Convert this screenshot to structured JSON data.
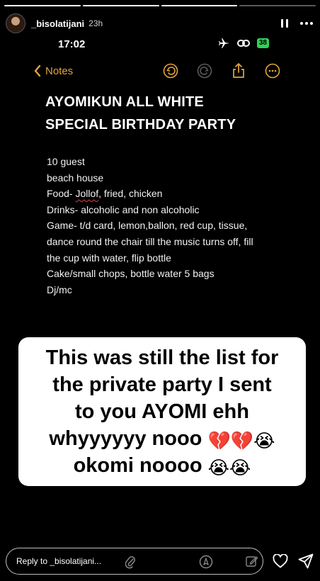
{
  "story": {
    "segments": 4,
    "username": "_bisolatijani",
    "time_ago": "23h"
  },
  "status_bar": {
    "clock": "17:02",
    "battery": "38"
  },
  "notes": {
    "back_label": "Notes",
    "title_lines": [
      "AYOMIKUN ALL WHITE",
      "SPECIAL BIRTHDAY PARTY"
    ],
    "body": {
      "guests": "10 guest",
      "venue": "beach house",
      "food_prefix": "Food- ",
      "food_misspelled": "Jollof",
      "food_rest": ", fried, chicken",
      "drinks": "Drinks- alcoholic and non alcoholic",
      "game_1": "Game- t/d card, lemon,ballon, red cup, tissue,",
      "game_2": "dance round the chair till the music turns off, fill",
      "game_3": "the cup with water, flip bottle",
      "cake": "Cake/small chops, bottle water 5 bags",
      "dj": "Dj/mc"
    }
  },
  "caption": {
    "line1": "This was still the list for",
    "line2": "the private party I sent",
    "line3": "to you AYOMI ehh",
    "line4_text": "whyyyyyy nooo ",
    "line4_emojis": "💔💔😭",
    "line5_text": "okomi noooo ",
    "line5_emojis": "😭😭"
  },
  "reply": {
    "placeholder": "Reply to _bisolatijani..."
  },
  "colors": {
    "notes_accent": "#e2a53c",
    "background": "#000000"
  }
}
